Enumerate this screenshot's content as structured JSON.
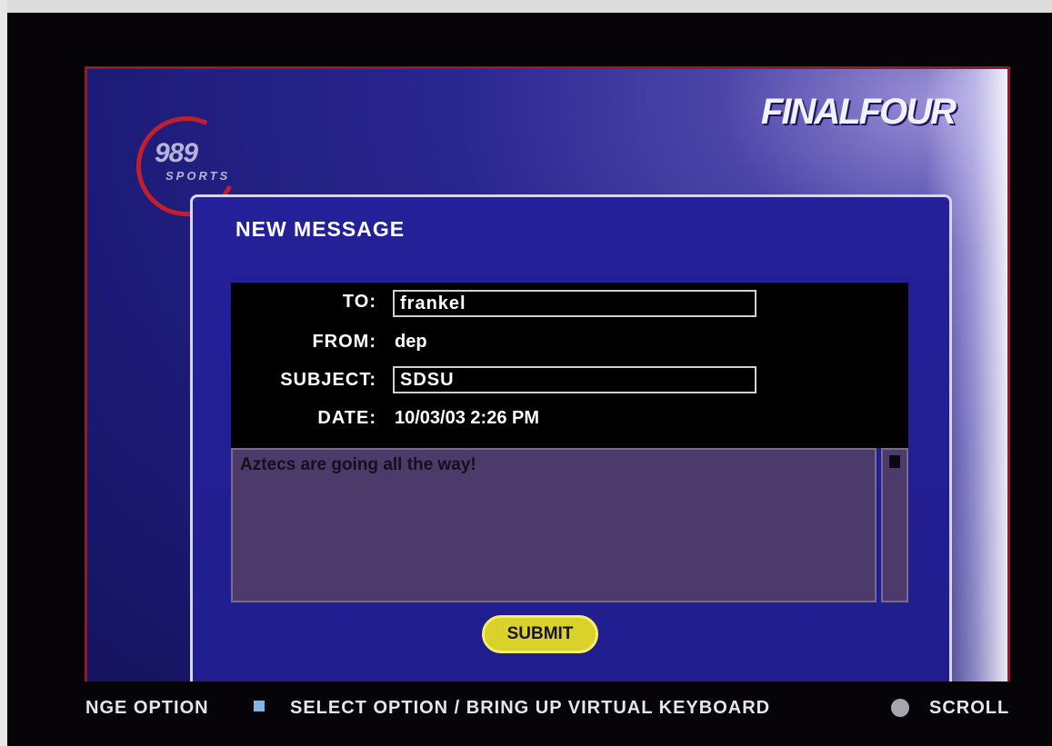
{
  "brand": {
    "logo_number": "989",
    "logo_sports": "SPORTS",
    "title": "FINALFOUR"
  },
  "panel": {
    "title": "NEW MESSAGE"
  },
  "fields": {
    "to_label": "TO:",
    "to_value": "frankel",
    "from_label": "FROM:",
    "from_value": "dep",
    "subject_label": "SUBJECT:",
    "subject_value": "SDSU",
    "date_label": "DATE:",
    "date_value": "10/03/03 2:26 PM"
  },
  "body": {
    "text": "Aztecs are going all the way!"
  },
  "submit_label": "SUBMIT",
  "status_bar": {
    "change_option": "NGE OPTION",
    "select_option": "SELECT OPTION / BRING UP VIRTUAL KEYBOARD",
    "scroll": "SCROLL",
    "square_icon": "square-button-icon",
    "circle_icon": "circle-button-icon"
  },
  "colors": {
    "screen_bg": "#1d1b78",
    "frame_border": "#8e1a2c",
    "submit_button": "#d9d22a",
    "body_area": "#4c3a6a"
  }
}
